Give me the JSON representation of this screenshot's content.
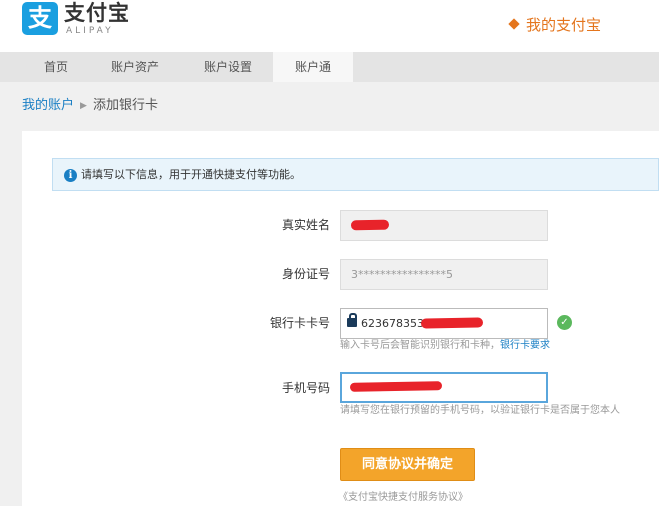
{
  "header": {
    "logo_glyph": "支",
    "logo_cn": "支付宝",
    "logo_en": "ALIPAY",
    "my_alipay": "我的支付宝"
  },
  "nav": {
    "items": [
      {
        "label": "首页"
      },
      {
        "label": "账户资产"
      },
      {
        "label": "账户设置"
      },
      {
        "label": "账户通"
      }
    ]
  },
  "breadcrumb": {
    "parent": "我的账户",
    "separator": "▶",
    "current": "添加银行卡"
  },
  "notice": {
    "icon": "i",
    "text": "请填写以下信息，用于开通快捷支付等功能。"
  },
  "form": {
    "name": {
      "label": "真实姓名"
    },
    "id": {
      "label": "身份证号",
      "value": "3****************5"
    },
    "card": {
      "label": "银行卡卡号",
      "value": "62367835300",
      "hint": "输入卡号后会智能识别银行和卡种，",
      "hint_link": "银行卡要求"
    },
    "phone": {
      "label": "手机号码",
      "hint": "请填写您在银行预留的手机号码，以验证银行卡是否属于您本人"
    },
    "submit": "同意协议并确定",
    "agreement": "《支付宝快捷支付服务协议》"
  },
  "icons": {
    "info": "info-icon",
    "lock": "lock-icon",
    "check": "check-circle-icon",
    "logo": "alipay-logo-icon"
  },
  "colors": {
    "brand_blue": "#1a9fe0",
    "accent_orange": "#e4751d",
    "button_orange": "#f3a42a",
    "link_blue": "#1a7fc4",
    "success_green": "#5bb85d",
    "redaction_red": "#e8232a"
  }
}
